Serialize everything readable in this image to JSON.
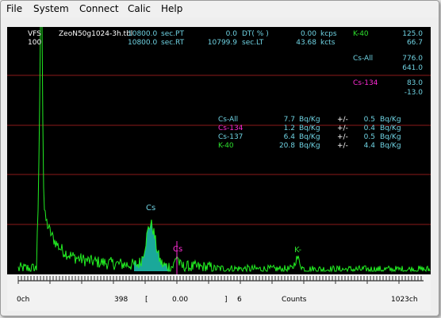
{
  "menu": [
    "File",
    "System",
    "Connect",
    "Calic",
    "Help"
  ],
  "readouts": {
    "vfs_label": "VFS",
    "vfs_value": "100",
    "filename": "ZeoN50g1024-3h.tbl",
    "pt_value": "10800.0",
    "pt_label": "sec.PT",
    "rt_value": "10800.0",
    "rt_label": "sec.RT",
    "dt_value": "0.0",
    "dt_label": "DT( % )",
    "lt_value": "10799.9",
    "lt_label": "sec.LT",
    "kcps_value": "0.00",
    "kcps_label": "kcps",
    "kcts_value": "43.68",
    "kcts_label": "kcts"
  },
  "rois": [
    {
      "name": "K-40",
      "v1": "125.0",
      "v2": "66.7",
      "color": "#2ddf2d"
    },
    {
      "name": "Cs-All",
      "v1": "776.0",
      "v2": "641.0",
      "color": "#6fd3e3"
    },
    {
      "name": "Cs-134",
      "v1": "83.0",
      "v2": "-13.0",
      "color": "#ff2bd6"
    }
  ],
  "results": [
    {
      "nuclide": "Cs-All",
      "value": "7.7",
      "unit": "Bq/Kg",
      "pm": "+/-",
      "err": "0.5",
      "err_unit": "Bq/Kg",
      "color": "#6fd3e3"
    },
    {
      "nuclide": "Cs-134",
      "value": "1.2",
      "unit": "Bq/Kg",
      "pm": "+/-",
      "err": "0.4",
      "err_unit": "Bq/Kg",
      "color": "#ff2bd6"
    },
    {
      "nuclide": "Cs-137",
      "value": "6.4",
      "unit": "Bq/Kg",
      "pm": "+/-",
      "err": "0.5",
      "err_unit": "Bq/Kg",
      "color": "#6fd3e3"
    },
    {
      "nuclide": "K-40",
      "value": "20.8",
      "unit": "Bq/Kg",
      "pm": "+/-",
      "err": "4.4",
      "err_unit": "Bq/Kg",
      "color": "#2ddf2d"
    }
  ],
  "peak_labels": {
    "cs": "Cs",
    "cs134": "Cs",
    "k": "K-"
  },
  "axis": {
    "start": "0ch",
    "cursor_ch": "398",
    "bracket_open": "[",
    "cursor_value": "0.00",
    "bracket_close": "]",
    "count": "6",
    "unit": "Counts",
    "end": "1023ch"
  },
  "colors": {
    "background": "#000000",
    "spectrum": "#22ee22",
    "fill": "#1aa89a",
    "gridline": "#8b1a1a",
    "cs134_marker": "#ff2bd6"
  }
}
